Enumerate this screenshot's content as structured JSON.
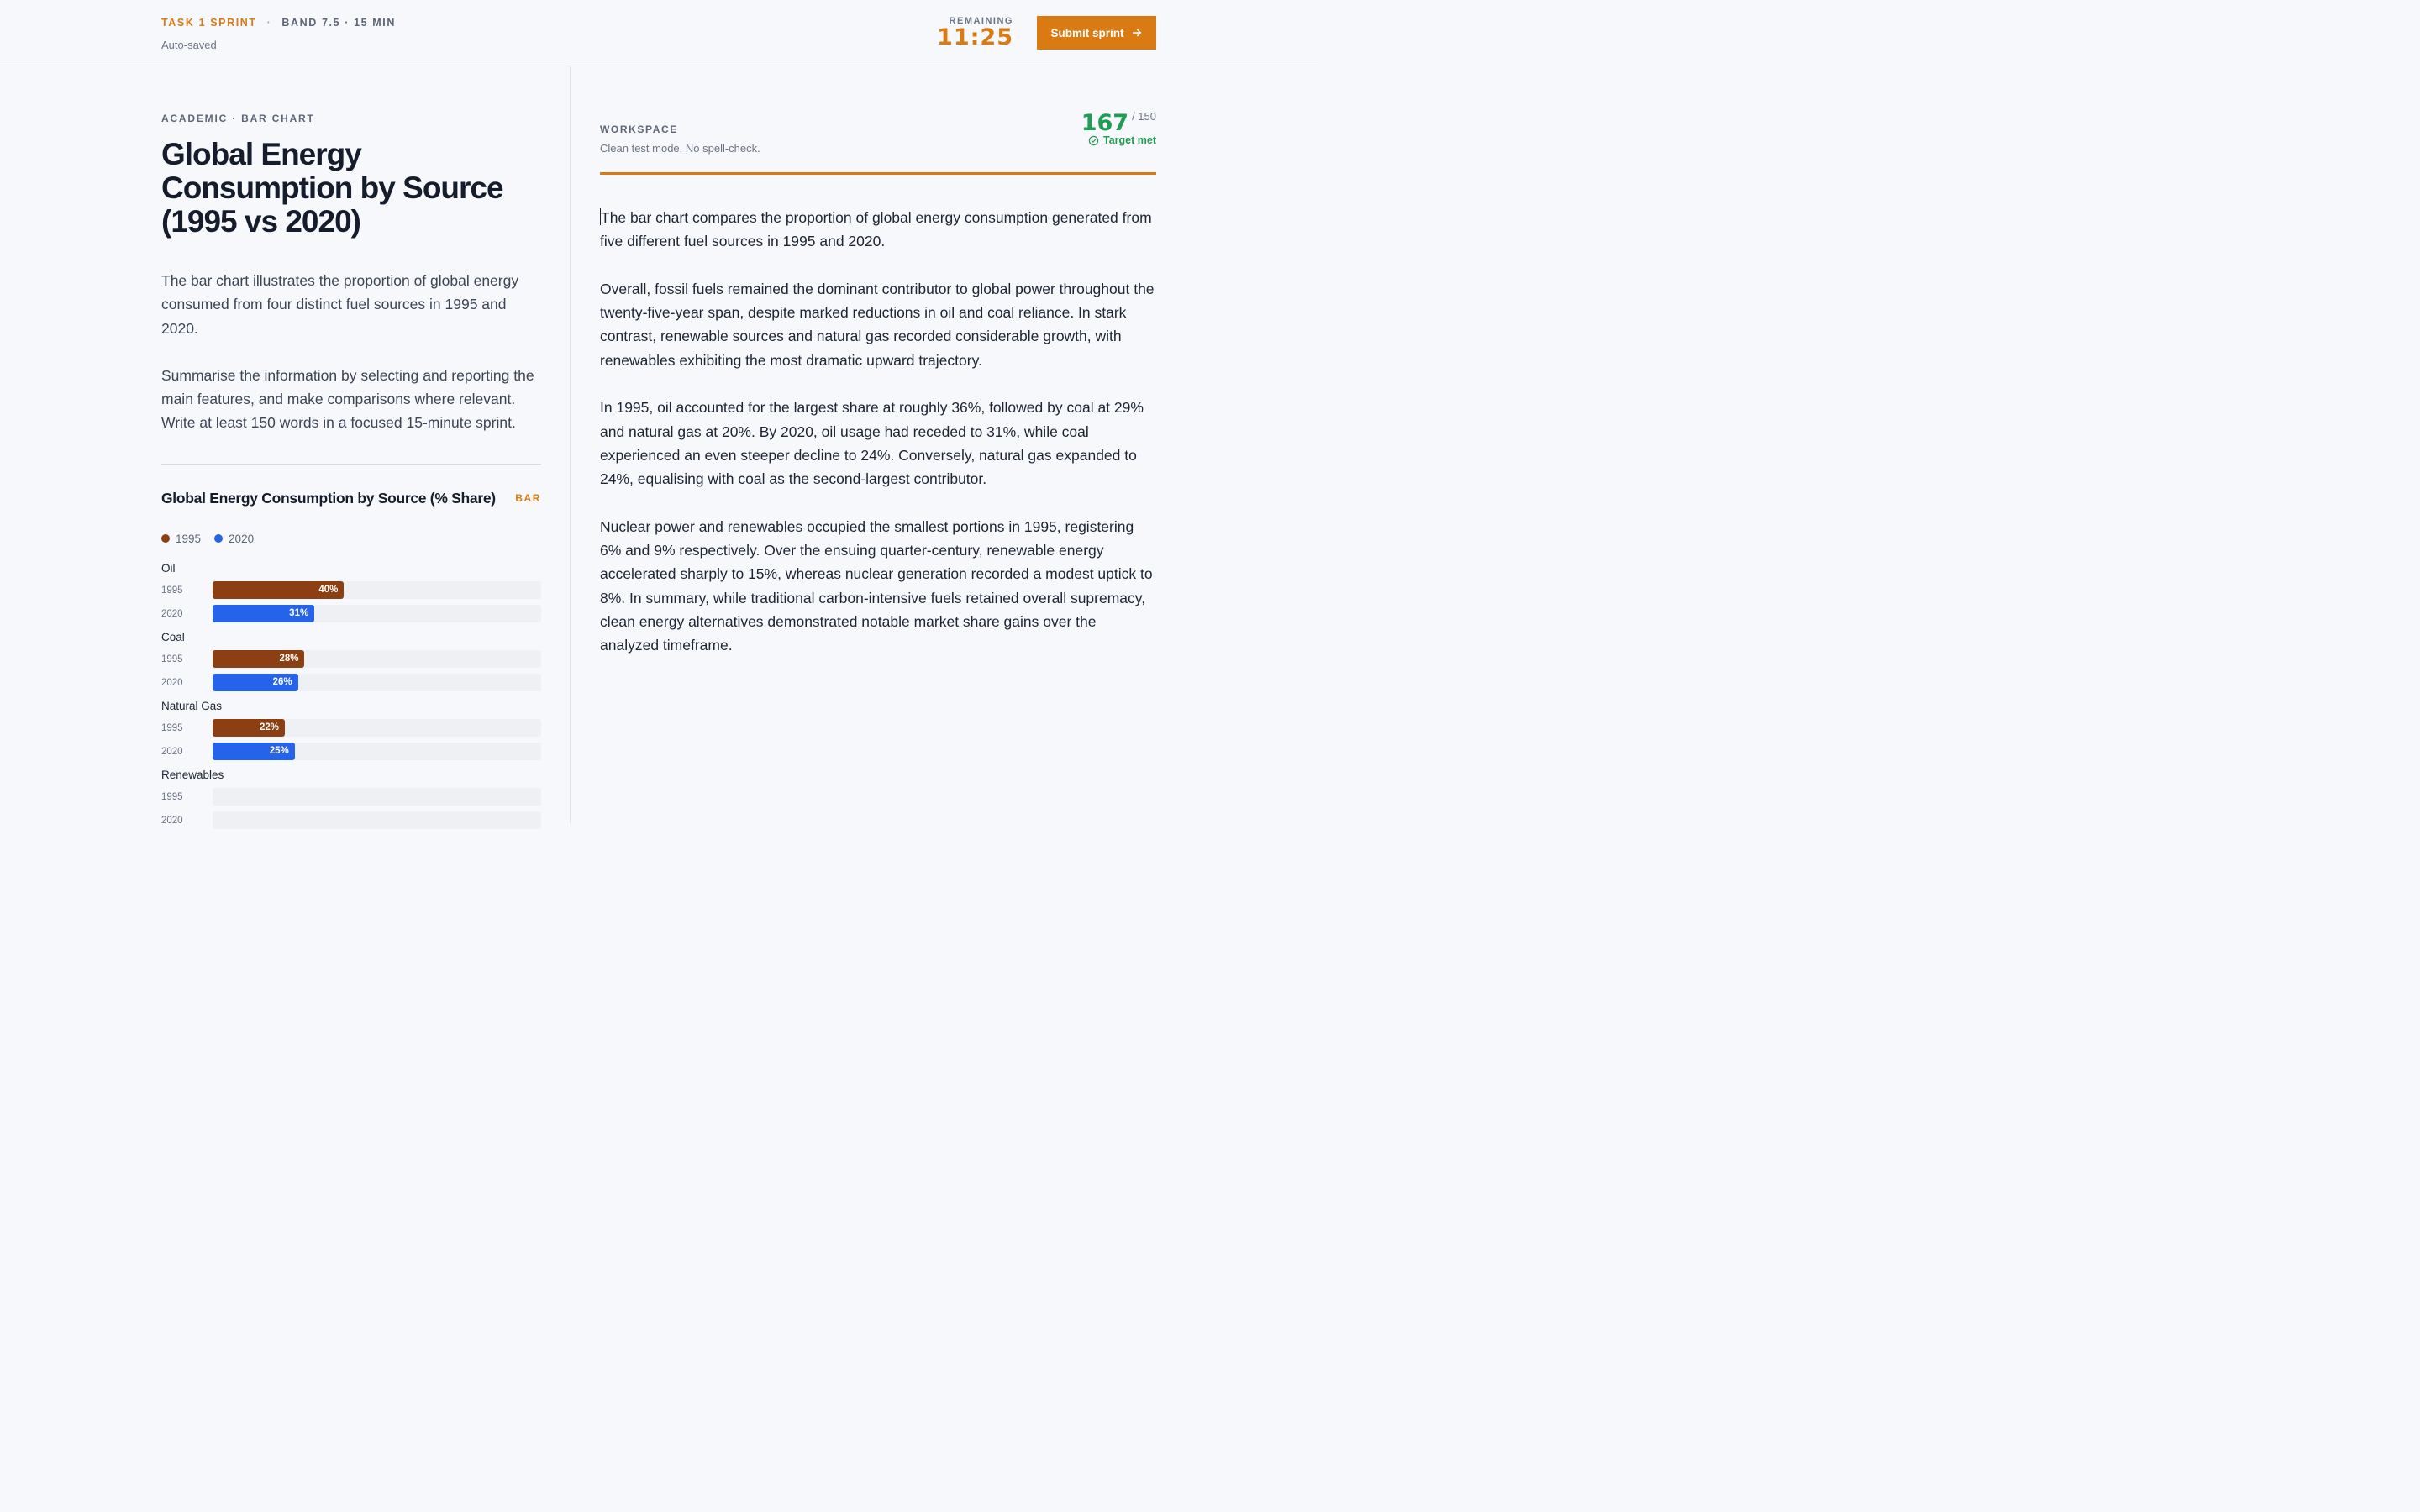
{
  "header": {
    "sprint_name": "TASK 1 SPRINT",
    "separator": "·",
    "meta": "BAND 7.5 · 15 MIN",
    "autosave": "Auto-saved",
    "timer_label": "REMAINING",
    "timer_value": "11:25",
    "submit_label": "Submit sprint"
  },
  "task": {
    "kicker": "ACADEMIC · BAR CHART",
    "title": "Global Energy Consumption by Source (1995 vs 2020)",
    "prompt_1": "The bar chart illustrates the proportion of global energy consumed from four distinct fuel sources in 1995 and 2020.",
    "prompt_2": "Summarise the information by selecting and reporting the main features, and make comparisons where relevant.",
    "prompt_3": "Write at least 150 words in a focused 15-minute sprint."
  },
  "chart_data": {
    "type": "bar",
    "orientation": "horizontal",
    "title": "Global Energy Consumption by Source (% Share)",
    "type_badge": "BAR",
    "categories": [
      "Oil",
      "Coal",
      "Natural Gas",
      "Renewables"
    ],
    "series": [
      {
        "name": "1995",
        "color": "#8b3f12",
        "values": [
          40,
          28,
          22,
          null
        ]
      },
      {
        "name": "2020",
        "color": "#2563eb",
        "values": [
          31,
          26,
          25,
          null
        ]
      }
    ],
    "value_suffix": "%",
    "xlim": [
      0,
      100
    ],
    "legend": "top-left"
  },
  "workspace": {
    "label": "WORKSPACE",
    "subtitle": "Clean test mode. No spell-check.",
    "word_count": "167",
    "word_target": "/ 150",
    "target_status": "Target met",
    "progress_fraction": 1.0,
    "essay": [
      "The bar chart compares the proportion of global energy consumption generated from five different fuel sources in 1995 and 2020.",
      "Overall, fossil fuels remained the dominant contributor to global power throughout the twenty-five-year span, despite marked reductions in oil and coal reliance. In stark contrast, renewable sources and natural gas recorded considerable growth, with renewables exhibiting the most dramatic upward trajectory.",
      "In 1995, oil accounted for the largest share at roughly 36%, followed by coal at 29% and natural gas at 20%. By 2020, oil usage had receded to 31%, while coal experienced an even steeper decline to 24%. Conversely, natural gas expanded to 24%, equalising with coal as the second-largest contributor.",
      "Nuclear power and renewables occupied the smallest portions in 1995, registering 6% and 9% respectively. Over the ensuing quarter-century, renewable energy accelerated sharply to 15%, whereas nuclear generation recorded a modest uptick to 8%. In summary, while traditional carbon-intensive fuels retained overall supremacy, clean energy alternatives demonstrated notable market share gains over the analyzed timeframe."
    ]
  },
  "colors": {
    "accent": "#d97a12",
    "success": "#1f9d55",
    "series_1995": "#8b3f12",
    "series_2020": "#2563eb"
  }
}
